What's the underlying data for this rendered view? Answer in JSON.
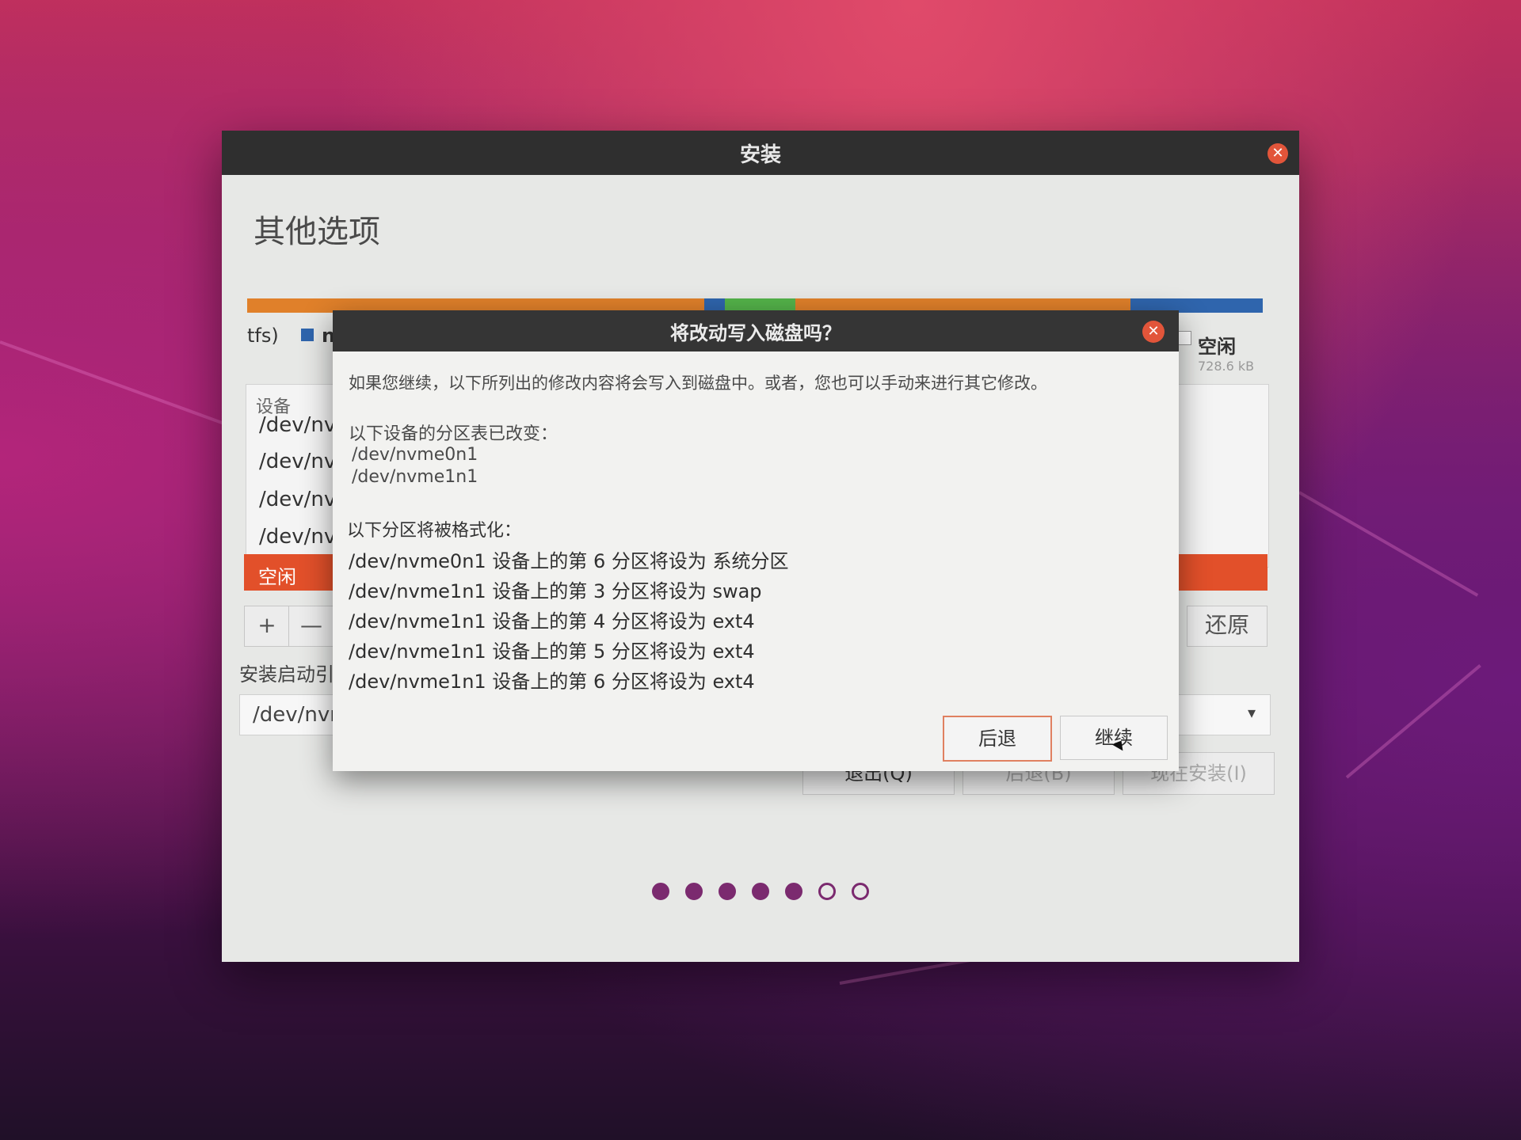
{
  "window": {
    "title": "安装",
    "page_title": "其他选项",
    "legend": {
      "fs_fragment": "tfs)",
      "dev_fragment": "nv",
      "free_label": "空闲",
      "free_size": "728.6 kB"
    },
    "table": {
      "column_device": "设备",
      "rows": [
        "/dev/nvn",
        "/dev/nvn",
        "/dev/nvn",
        "/dev/nvn"
      ],
      "free_row": "空闲"
    },
    "buttons": {
      "add": "+",
      "remove": "—",
      "revert": "还原"
    },
    "boot_loader": {
      "label": "安装启动引",
      "value": "/dev/nvn",
      "arrow": "▾"
    },
    "nav": {
      "quit": "退出(Q)",
      "back": "后退(B)",
      "install": "现在安装(I)"
    },
    "progress_dots": {
      "total": 7,
      "filled": 5
    },
    "colors": {
      "orange": "#e0802a",
      "blue": "#2f65ad",
      "green": "#54b34a",
      "red": "#e2502a",
      "purple": "#7b2a6f"
    }
  },
  "dialog": {
    "title": "将改动写入磁盘吗？",
    "intro": "如果您继续，以下所列出的修改内容将会写入到磁盘中。或者，您也可以手动来进行其它修改。",
    "partition_table_header": "以下设备的分区表已改变：",
    "partition_table_devices": [
      "/dev/nvme0n1",
      "/dev/nvme1n1"
    ],
    "format_header": "以下分区将被格式化：",
    "format_items": [
      "/dev/nvme0n1 设备上的第 6 分区将设为 系统分区",
      "/dev/nvme1n1 设备上的第 3 分区将设为 swap",
      "/dev/nvme1n1 设备上的第 4 分区将设为 ext4",
      "/dev/nvme1n1 设备上的第 5 分区将设为 ext4",
      "/dev/nvme1n1 设备上的第 6 分区将设为 ext4"
    ],
    "back_button": "后退",
    "continue_button": "继续",
    "close_icon": "close-icon"
  }
}
